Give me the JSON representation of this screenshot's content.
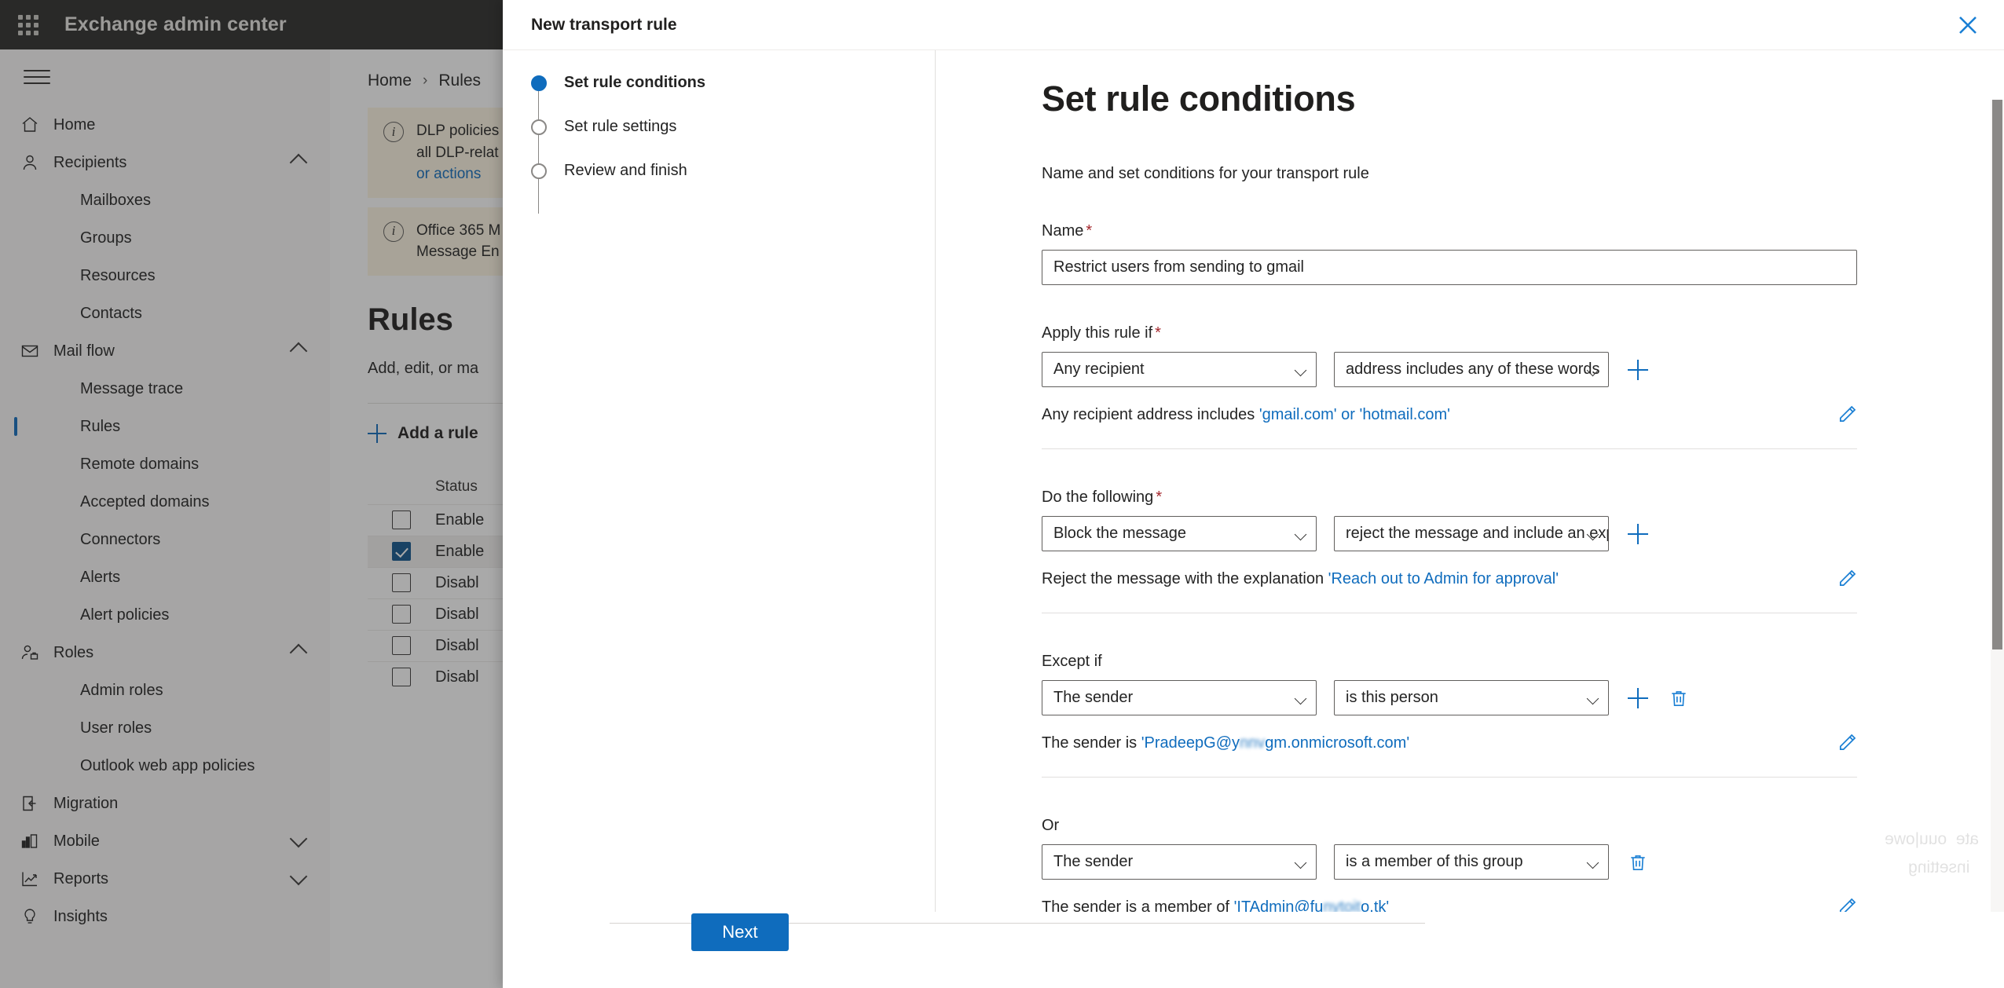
{
  "suite": {
    "title": "Exchange admin center",
    "waffle_icon": "app-launcher-icon"
  },
  "nav": {
    "menu_icon": "hamburger-icon",
    "items": [
      {
        "label": "Home",
        "icon": "home-icon",
        "level": 0,
        "chevron": "",
        "selected": false
      },
      {
        "label": "Recipients",
        "icon": "person-icon",
        "level": 0,
        "chevron": "up",
        "selected": false
      },
      {
        "label": "Mailboxes",
        "icon": "",
        "level": 1,
        "chevron": "",
        "selected": false
      },
      {
        "label": "Groups",
        "icon": "",
        "level": 1,
        "chevron": "",
        "selected": false
      },
      {
        "label": "Resources",
        "icon": "",
        "level": 1,
        "chevron": "",
        "selected": false
      },
      {
        "label": "Contacts",
        "icon": "",
        "level": 1,
        "chevron": "",
        "selected": false
      },
      {
        "label": "Mail flow",
        "icon": "mail-icon",
        "level": 0,
        "chevron": "up",
        "selected": false
      },
      {
        "label": "Message trace",
        "icon": "",
        "level": 1,
        "chevron": "",
        "selected": false
      },
      {
        "label": "Rules",
        "icon": "",
        "level": 1,
        "chevron": "",
        "selected": true
      },
      {
        "label": "Remote domains",
        "icon": "",
        "level": 1,
        "chevron": "",
        "selected": false
      },
      {
        "label": "Accepted domains",
        "icon": "",
        "level": 1,
        "chevron": "",
        "selected": false
      },
      {
        "label": "Connectors",
        "icon": "",
        "level": 1,
        "chevron": "",
        "selected": false
      },
      {
        "label": "Alerts",
        "icon": "",
        "level": 1,
        "chevron": "",
        "selected": false
      },
      {
        "label": "Alert policies",
        "icon": "",
        "level": 1,
        "chevron": "",
        "selected": false
      },
      {
        "label": "Roles",
        "icon": "roles-icon",
        "level": 0,
        "chevron": "up",
        "selected": false
      },
      {
        "label": "Admin roles",
        "icon": "",
        "level": 1,
        "chevron": "",
        "selected": false
      },
      {
        "label": "User roles",
        "icon": "",
        "level": 1,
        "chevron": "",
        "selected": false
      },
      {
        "label": "Outlook web app policies",
        "icon": "",
        "level": 1,
        "chevron": "",
        "selected": false
      },
      {
        "label": "Migration",
        "icon": "migration-icon",
        "level": 0,
        "chevron": "",
        "selected": false
      },
      {
        "label": "Mobile",
        "icon": "mobile-icon",
        "level": 0,
        "chevron": "down",
        "selected": false
      },
      {
        "label": "Reports",
        "icon": "reports-icon",
        "level": 0,
        "chevron": "down",
        "selected": false
      },
      {
        "label": "Insights",
        "icon": "bulb-icon",
        "level": 0,
        "chevron": "",
        "selected": false
      }
    ]
  },
  "page": {
    "breadcrumb": [
      "Home",
      "Rules"
    ],
    "breadcrumb_separator_icon": "chevron-right-icon",
    "banners": [
      {
        "icon": "info-icon",
        "text": "DLP policies ",
        "text2": "all DLP-relat",
        "link": "or actions"
      },
      {
        "icon": "info-icon",
        "text": "Office 365 M",
        "text2": "Message En",
        "link": ""
      }
    ],
    "title": "Rules",
    "subtitle": "Add, edit, or ma",
    "add_rule_label": "Add a rule",
    "add_rule_icon": "plus-icon",
    "table": {
      "headers": [
        "Status"
      ],
      "rows": [
        {
          "checked": false,
          "status": "Enable"
        },
        {
          "checked": true,
          "status": "Enable"
        },
        {
          "checked": false,
          "status": "Disabl"
        },
        {
          "checked": false,
          "status": "Disabl"
        },
        {
          "checked": false,
          "status": "Disabl"
        },
        {
          "checked": false,
          "status": "Disabl"
        }
      ]
    }
  },
  "dialog": {
    "title": "New transport rule",
    "close_icon": "close-icon",
    "steps": [
      {
        "label": "Set rule conditions",
        "active": true
      },
      {
        "label": "Set rule settings",
        "active": false
      },
      {
        "label": "Review and finish",
        "active": false
      }
    ],
    "form": {
      "heading": "Set rule conditions",
      "description": "Name and set conditions for your transport rule",
      "name_label": "Name",
      "name_required": "*",
      "name_value": "Restrict users from sending to gmail",
      "name_placeholder": "",
      "sections": [
        {
          "label": "Apply this rule if",
          "required": "*",
          "dropdown1": "Any recipient",
          "dropdown2": "address includes any of these words",
          "summary_prefix": "Any recipient address includes ",
          "summary_value": "'gmail.com' or 'hotmail.com'",
          "summary_redacted": "",
          "summary_suffix": "",
          "has_add": true,
          "has_delete": false,
          "has_edit": true,
          "divider": true
        },
        {
          "label": "Do the following",
          "required": "*",
          "dropdown1": "Block the message",
          "dropdown2": "reject the message and include an exp...",
          "summary_prefix": "Reject the message with the explanation ",
          "summary_value": "'Reach out to Admin for approval'",
          "summary_redacted": "",
          "summary_suffix": "",
          "has_add": true,
          "has_delete": false,
          "has_edit": true,
          "divider": true
        },
        {
          "label": "Except if",
          "required": "",
          "dropdown1": "The sender",
          "dropdown2": "is this person",
          "summary_prefix": "The sender is ",
          "summary_value": "'PradeepG@y",
          "summary_redacted": "nnv",
          "summary_suffix": "gm.onmicrosoft.com'",
          "has_add": true,
          "has_delete": true,
          "has_edit": true,
          "divider": true
        },
        {
          "label": "Or",
          "required": "",
          "dropdown1": "The sender",
          "dropdown2": "is a member of this group",
          "summary_prefix": "The sender is a member of ",
          "summary_value": "'ITAdmin@fu",
          "summary_redacted": "nytoit",
          "summary_suffix": "o.tk'",
          "has_add": false,
          "has_delete": true,
          "has_edit": true,
          "divider": true
        }
      ],
      "add_icon": "plus-icon",
      "delete_icon": "trash-icon",
      "edit_icon": "pencil-icon",
      "dropdown_icon": "chevron-down-icon"
    },
    "next_label": "Next",
    "scrollbar_name": "vertical-scrollbar"
  },
  "colors": {
    "accent": "#0f6cbd",
    "suite_bar": "#2b2a28",
    "required": "#a4262c",
    "checkbox_checked": "#0f548c",
    "banner_bg": "#fdf6e3"
  }
}
